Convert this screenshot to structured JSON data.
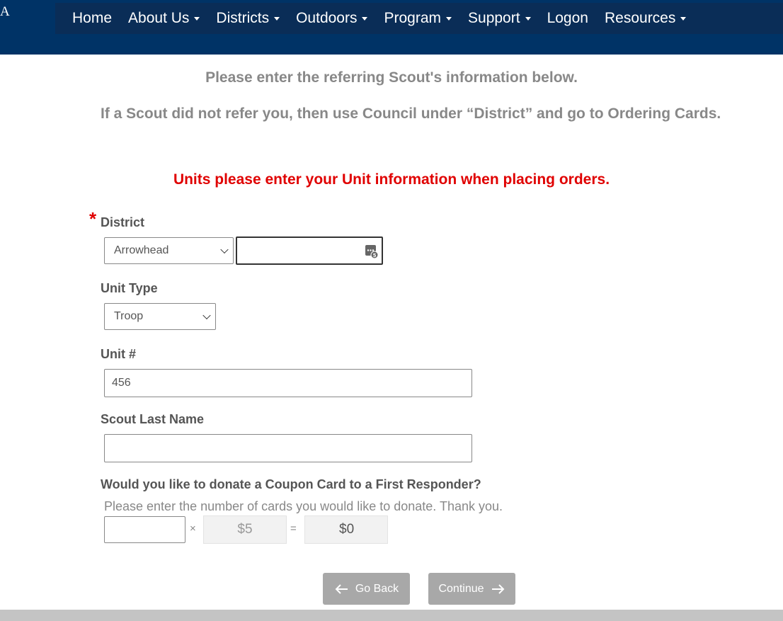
{
  "brand": {
    "letter": "A"
  },
  "nav": {
    "items": [
      {
        "label": "Home",
        "dropdown": false,
        "name": "nav-home"
      },
      {
        "label": "About Us",
        "dropdown": true,
        "name": "nav-about-us"
      },
      {
        "label": "Districts",
        "dropdown": true,
        "name": "nav-districts"
      },
      {
        "label": "Outdoors",
        "dropdown": true,
        "name": "nav-outdoors"
      },
      {
        "label": "Program",
        "dropdown": true,
        "name": "nav-program"
      },
      {
        "label": "Support",
        "dropdown": true,
        "name": "nav-support"
      },
      {
        "label": "Logon",
        "dropdown": false,
        "name": "nav-logon"
      },
      {
        "label": "Resources",
        "dropdown": true,
        "name": "nav-resources"
      }
    ]
  },
  "intro": {
    "line1": "Please enter the referring Scout's information below.",
    "line2": "If a Scout did not refer you, then use Council under “District” and go to Ordering Cards.",
    "notice": "Units please enter your Unit information when placing orders."
  },
  "form": {
    "required_mark": "*",
    "district": {
      "label": "District",
      "selected": "Arrowhead",
      "secondary_value": ""
    },
    "unit_type": {
      "label": "Unit Type",
      "selected": "Troop"
    },
    "unit_number": {
      "label": "Unit #",
      "value": "456"
    },
    "scout_last_name": {
      "label": "Scout Last Name",
      "value": ""
    },
    "donation": {
      "question": "Would you like to donate a Coupon Card to a First Responder?",
      "hint": "Please enter the number of cards you would like to donate. Thank you.",
      "quantity": "",
      "times": "×",
      "unit_price": "$5",
      "equals": "=",
      "total": "$0"
    }
  },
  "buttons": {
    "back": "Go Back",
    "continue": "Continue"
  },
  "colors": {
    "header": "#003366",
    "nav": "#0a2d57",
    "notice": "#e00000",
    "button": "#a8a8a8"
  }
}
